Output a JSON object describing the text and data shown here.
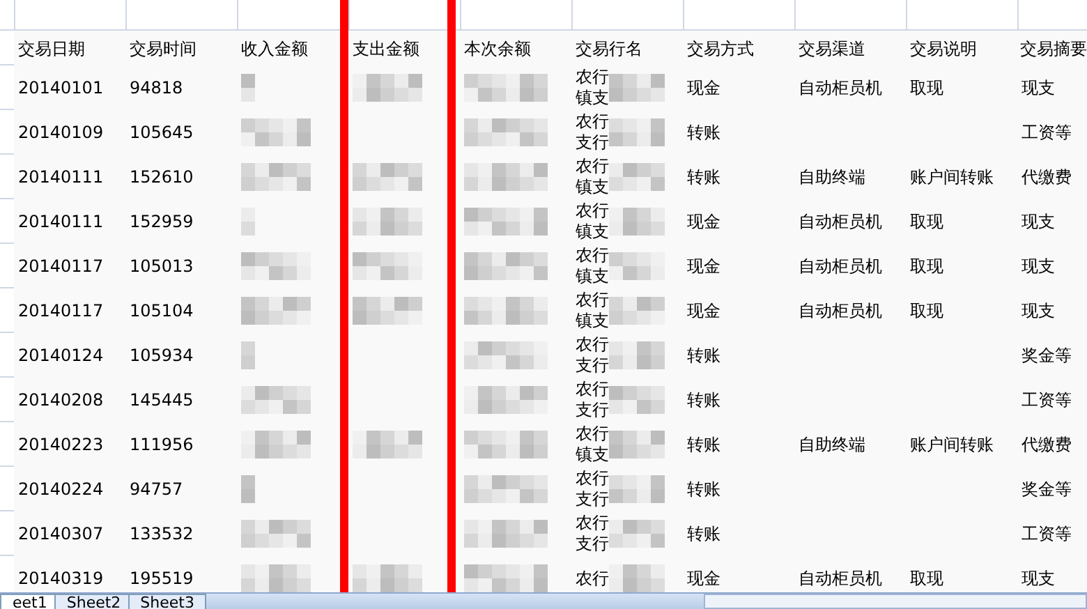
{
  "columns": [
    "交易日期",
    "交易时间",
    "收入金额",
    "支出金额",
    "本次余额",
    "交易行名",
    "交易方式",
    "交易渠道",
    "交易说明",
    "交易摘要"
  ],
  "rows": [
    {
      "date": "20140101",
      "time": "94818",
      "income_blurred": true,
      "expense_blurred": true,
      "balance_blurred": true,
      "bank_line1": "农行",
      "bank_line2": "镇支",
      "method": "现金",
      "channel": "自动柜员机",
      "description": "取现",
      "summary": "现支"
    },
    {
      "date": "20140109",
      "time": "105645",
      "income_blurred": true,
      "expense_blurred": false,
      "balance_blurred": true,
      "bank_line1": "农行",
      "bank_line2": "支行",
      "method": "转账",
      "summary": "工资等"
    },
    {
      "date": "20140111",
      "time": "152610",
      "income_blurred": true,
      "expense_blurred": true,
      "balance_blurred": true,
      "bank_line1": "农行",
      "bank_line2": "镇支",
      "method": "转账",
      "channel": "自助终端",
      "description": "账户间转账",
      "summary": "代缴费"
    },
    {
      "date": "20140111",
      "time": "152959",
      "income_blurred": true,
      "expense_blurred": true,
      "balance_blurred": true,
      "bank_line1": "农行",
      "bank_line2": "镇支",
      "method": "现金",
      "channel": "自动柜员机",
      "description": "取现",
      "summary": "现支"
    },
    {
      "date": "20140117",
      "time": "105013",
      "income_blurred": true,
      "expense_blurred": true,
      "balance_blurred": true,
      "bank_line1": "农行",
      "bank_line2": "镇支",
      "method": "现金",
      "channel": "自动柜员机",
      "description": "取现",
      "summary": "现支"
    },
    {
      "date": "20140117",
      "time": "105104",
      "income_blurred": true,
      "expense_blurred": true,
      "balance_blurred": true,
      "bank_line1": "农行",
      "bank_line2": "镇支",
      "method": "现金",
      "channel": "自动柜员机",
      "description": "取现",
      "summary": "现支"
    },
    {
      "date": "20140124",
      "time": "105934",
      "income_blurred": true,
      "expense_blurred": false,
      "balance_blurred": true,
      "bank_line1": "农行",
      "bank_line2": "支行",
      "method": "转账",
      "summary": "奖金等"
    },
    {
      "date": "20140208",
      "time": "145445",
      "income_blurred": true,
      "expense_blurred": false,
      "balance_blurred": true,
      "bank_line1": "农行",
      "bank_line2": "支行",
      "method": "转账",
      "summary": "工资等"
    },
    {
      "date": "20140223",
      "time": "111956",
      "income_blurred": true,
      "expense_blurred": true,
      "balance_blurred": true,
      "bank_line1": "农行",
      "bank_line2": "镇支",
      "method": "转账",
      "channel": "自助终端",
      "description": "账户间转账",
      "summary": "代缴费"
    },
    {
      "date": "20140224",
      "time": "94757",
      "income_blurred": true,
      "expense_blurred": false,
      "balance_blurred": true,
      "bank_line1": "农行",
      "bank_line2": "支行",
      "method": "转账",
      "summary": "奖金等"
    },
    {
      "date": "20140307",
      "time": "133532",
      "income_blurred": true,
      "expense_blurred": false,
      "balance_blurred": true,
      "bank_line1": "农行",
      "bank_line2": "支行",
      "method": "转账",
      "summary": "工资等"
    },
    {
      "date": "20140319",
      "time": "195519",
      "income_blurred": true,
      "expense_blurred": true,
      "balance_blurred": true,
      "bank_line1": "农行",
      "method": "现金",
      "channel": "自动柜员机",
      "description": "取现",
      "summary": "现支"
    }
  ],
  "sheet_tabs": [
    {
      "label": "eet1",
      "selected": true
    },
    {
      "label": "Sheet2",
      "selected": false
    },
    {
      "label": "Sheet3",
      "selected": false
    }
  ]
}
